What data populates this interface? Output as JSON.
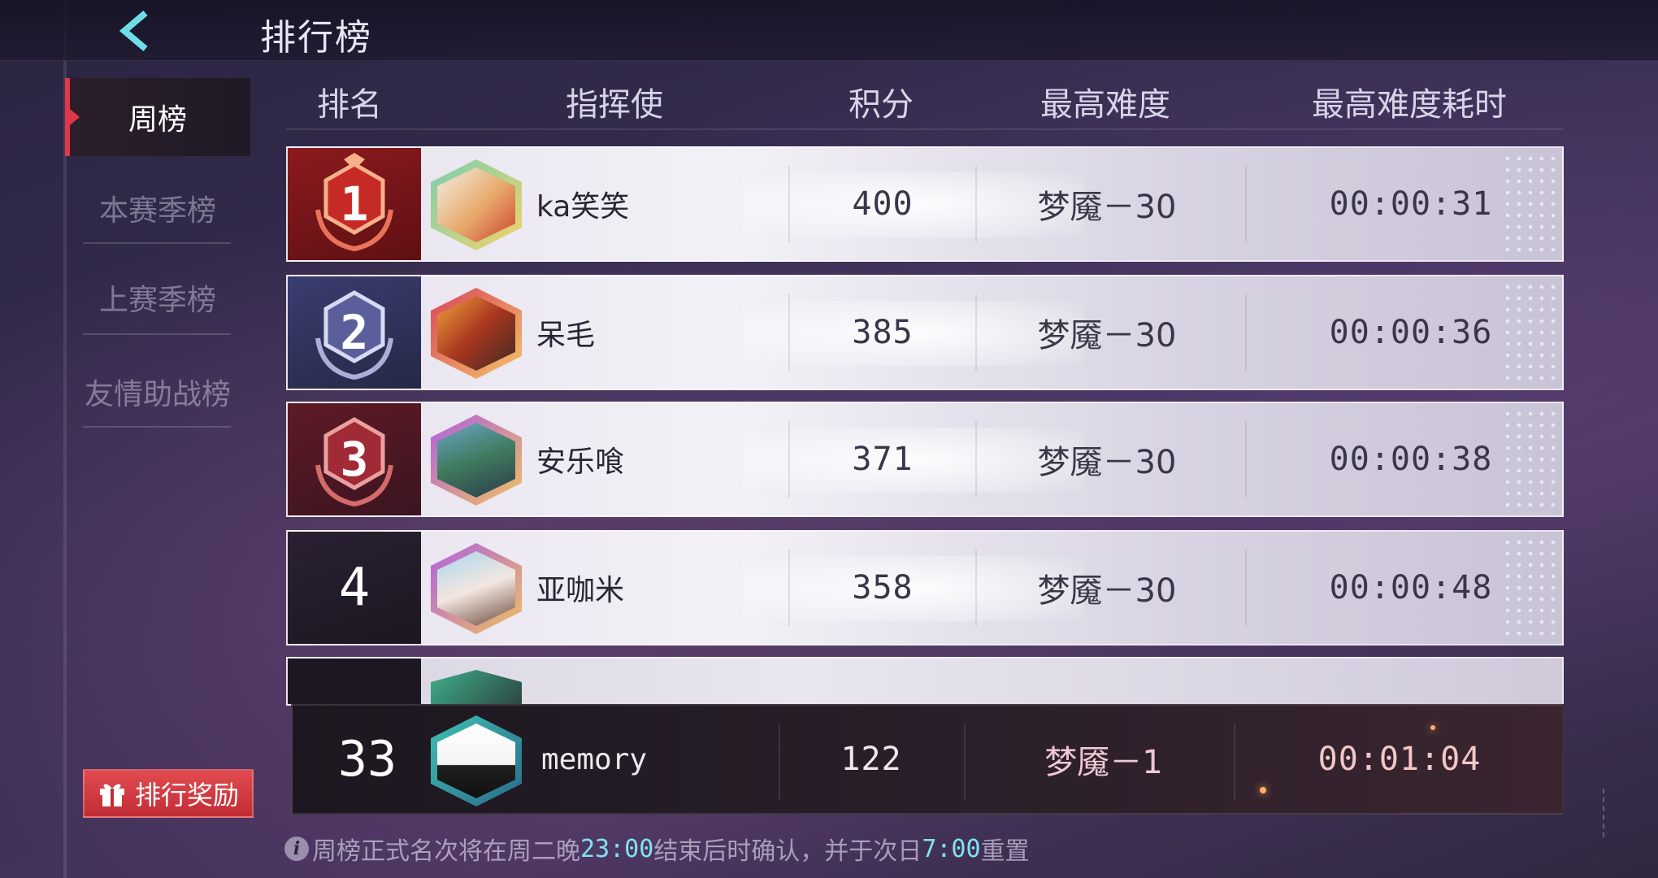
{
  "header": {
    "title": "排行榜"
  },
  "sidebar": {
    "items": [
      {
        "label": "周榜",
        "active": true
      },
      {
        "label": "本赛季榜",
        "active": false
      },
      {
        "label": "上赛季榜",
        "active": false
      },
      {
        "label": "友情助战榜",
        "active": false
      }
    ]
  },
  "table": {
    "columns": [
      "排名",
      "指挥使",
      "积分",
      "最高难度",
      "最高难度耗时"
    ],
    "rows": [
      {
        "rank": "1",
        "name": "ka笑笑",
        "score": "400",
        "difficulty": "梦魇－30",
        "time": "00:00:31"
      },
      {
        "rank": "2",
        "name": "呆毛",
        "score": "385",
        "difficulty": "梦魇－30",
        "time": "00:00:36"
      },
      {
        "rank": "3",
        "name": "安乐喰",
        "score": "371",
        "difficulty": "梦魇－30",
        "time": "00:00:38"
      },
      {
        "rank": "4",
        "name": "亚咖米",
        "score": "358",
        "difficulty": "梦魇－30",
        "time": "00:00:48"
      }
    ]
  },
  "my_rank": {
    "rank": "33",
    "name": "memory",
    "score": "122",
    "difficulty": "梦魇－1",
    "time": "00:01:04"
  },
  "reward_button": {
    "label": "排行奖励"
  },
  "notice": {
    "part1": "周榜正式名次将在周二晚 ",
    "time1": "23:00",
    "part2": "结束后时确认，并于次日 ",
    "time2": "7:00",
    "part3": " 重置"
  },
  "colors": {
    "accent_red": "#e2374a",
    "highlight_cyan": "#7fe3f0"
  }
}
